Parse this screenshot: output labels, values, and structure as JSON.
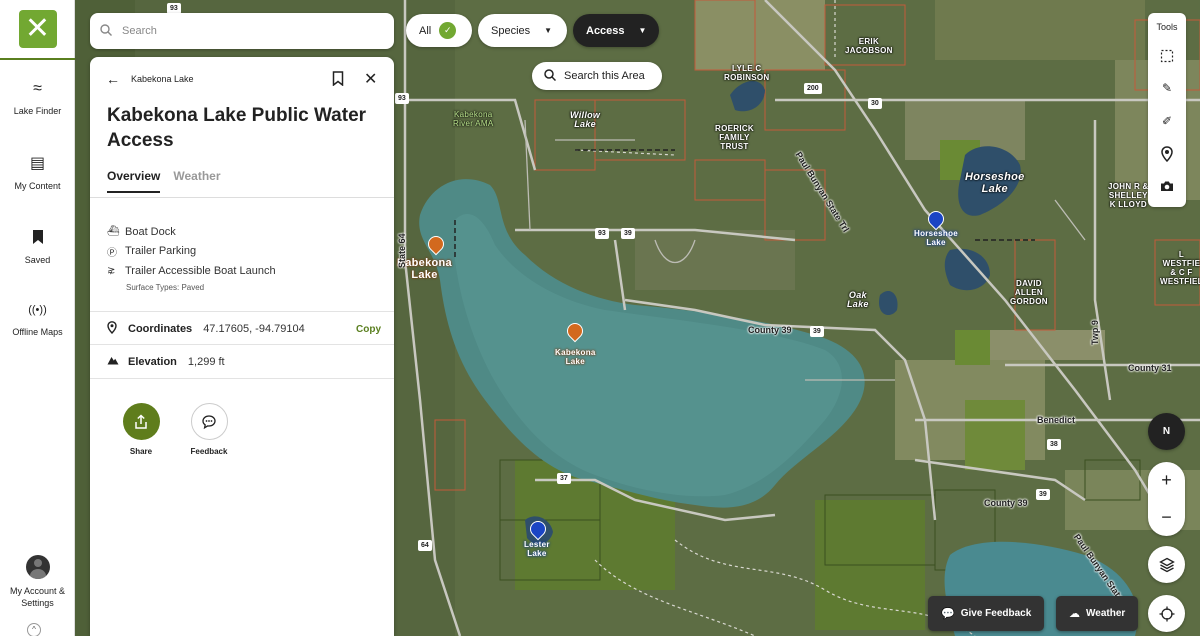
{
  "nav": {
    "logo": "✕",
    "items": [
      {
        "label": "Lake Finder",
        "icon": "waves-icon"
      },
      {
        "label": "My Content",
        "icon": "folder-icon"
      },
      {
        "label": "Saved",
        "icon": "bookmark-icon"
      },
      {
        "label": "Offline Maps",
        "icon": "offline-signal-icon"
      }
    ],
    "account_label": "My Account & Settings"
  },
  "search": {
    "placeholder": "Search",
    "value": ""
  },
  "panel": {
    "breadcrumb": "Kabekona Lake",
    "title": "Kabekona Lake Public Water Access",
    "tabs": [
      {
        "label": "Overview",
        "active": true
      },
      {
        "label": "Weather",
        "active": false
      }
    ],
    "amenities": [
      {
        "label": "Boat Dock",
        "icon": "boat-icon"
      },
      {
        "label": "Trailer Parking",
        "icon": "parking-icon"
      },
      {
        "label": "Trailer Accessible Boat Launch",
        "icon": "boat-launch-icon"
      }
    ],
    "surface_types": "Surface Types: Paved",
    "coordinates": {
      "label": "Coordinates",
      "value": "47.17605, -94.79104",
      "copy_label": "Copy"
    },
    "elevation": {
      "label": "Elevation",
      "value": "1,299 ft"
    },
    "actions": [
      {
        "label": "Share",
        "icon": "share-icon"
      },
      {
        "label": "Feedback",
        "icon": "feedback-icon"
      }
    ]
  },
  "filters": {
    "all_label": "All",
    "species_label": "Species",
    "access_label": "Access",
    "search_area_label": "Search this Area"
  },
  "tools": {
    "title": "Tools",
    "items": [
      "lasso-select-icon",
      "pen-icon",
      "edit-line-icon",
      "location-pin-icon",
      "camera-icon"
    ]
  },
  "map_controls": {
    "compass_label": "N",
    "zoom_in": "+",
    "zoom_out": "−"
  },
  "bottom": {
    "feedback_label": "Give Feedback",
    "weather_label": "Weather"
  },
  "map_labels": {
    "kabekona_lake_big": "Kabekona\nLake",
    "kabekona_lake_pin": "Kabekona\nLake",
    "horseshoe_lake": "Horseshoe\nLake",
    "horseshoe_lake_access": "Horseshoe\nLake",
    "willow_lake": "Willow\nLake",
    "oak_lake": "Oak\nLake",
    "lester_lake": "Lester\nLake",
    "kabekona_river_ama": "Kabekona\nRiver AMA",
    "erik_jacobson": "ERIK\nJACOBSON",
    "lyle_robinson": "LYLE C\nROBINSON",
    "roerick_trust": "ROERICK\nFAMILY\nTRUST",
    "david_gordon": "DAVID\nALLEN\nGORDON",
    "john_lloyd": "JOHN R &\nSHELLEY\nK LLOYD",
    "westfield": "L WESTFIE\n& C F\nWESTFIEL",
    "benedict": "Benedict",
    "county39_a": "County 39",
    "county39_b": "County 39",
    "county31": "County 31",
    "paul_bunyan_a": "Paul Bunyan State Trl",
    "paul_bunyan_b": "Paul Bunyan State Trl",
    "state64": "State 64",
    "twp9": "Twp 9",
    "shield_93a": "93",
    "shield_93b": "93",
    "shield_93c": "93",
    "shield_39a": "39",
    "shield_30": "30",
    "shield_200": "200",
    "shield_38": "38",
    "shield_37": "37",
    "shield_64": "64",
    "shield_39b": "39",
    "shield_39c": "39"
  }
}
